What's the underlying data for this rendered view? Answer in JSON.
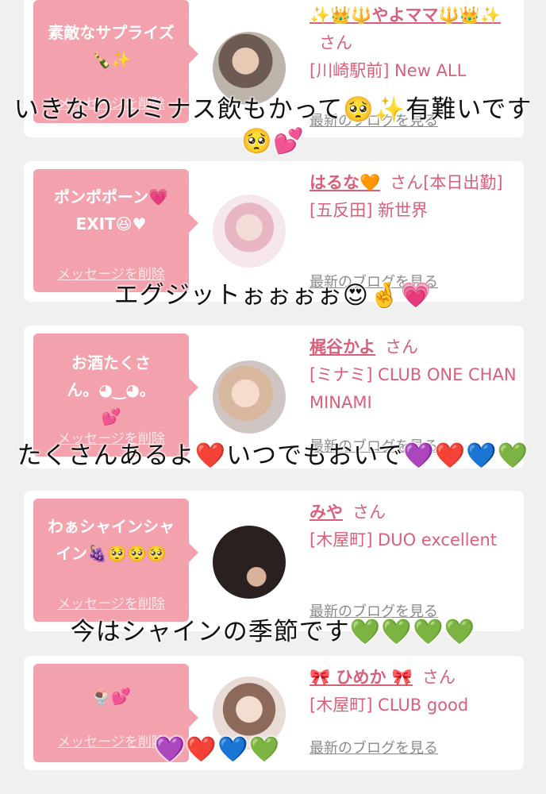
{
  "cards": [
    {
      "message": "素敵なサプライズ🍾✨",
      "delete_label": "メッセージを削除",
      "name": "✨👑🔱やよママ🔱👑✨",
      "honorific": "さん",
      "shop": "[川崎駅前] New ALL",
      "blog_label": "最新のブログを見る"
    },
    {
      "message": "ポンポポーン💗EXIT😆♥",
      "delete_label": "メッセージを削除",
      "name": "はるな🧡",
      "honorific": "さん[本日出勤]",
      "shop": "[五反田] 新世界",
      "blog_label": "最新のブログを見る"
    },
    {
      "message": "お酒たくさん。◕‿◕。💕",
      "delete_label": "メッセージを削除",
      "name": "梶谷かよ",
      "honorific": "さん",
      "shop": "[ミナミ] CLUB ONE CHAN MINAMI",
      "blog_label": "最新のブログを見る"
    },
    {
      "message": "わぁシャインシャイン🍇🥺🥺🥺",
      "delete_label": "メッセージを削除",
      "name": "みや",
      "honorific": "さん",
      "shop": "[木屋町] DUO excellent",
      "blog_label": "最新のブログを見る"
    },
    {
      "message": "🍨💕",
      "delete_label": "メッセージを削除",
      "name": "🎀 ひめか 🎀",
      "honorific": "さん",
      "shop": "[木屋町] CLUB good",
      "blog_label": "最新のブログを見る"
    }
  ],
  "captions": [
    "いきなりルミナス飲もかって🥺✨有難いです🥺💕",
    "エグジットぉぉぉぉ😍🤞💗",
    "たくさんあるよ❤️いつでもおいで💜❤️💙💚",
    "今はシャインの季節です💚💚💚💚",
    "💜❤️💙💚"
  ],
  "colors": {
    "accent": "#f3a1ac",
    "name": "#d9607a",
    "link": "#8a8a8a"
  }
}
